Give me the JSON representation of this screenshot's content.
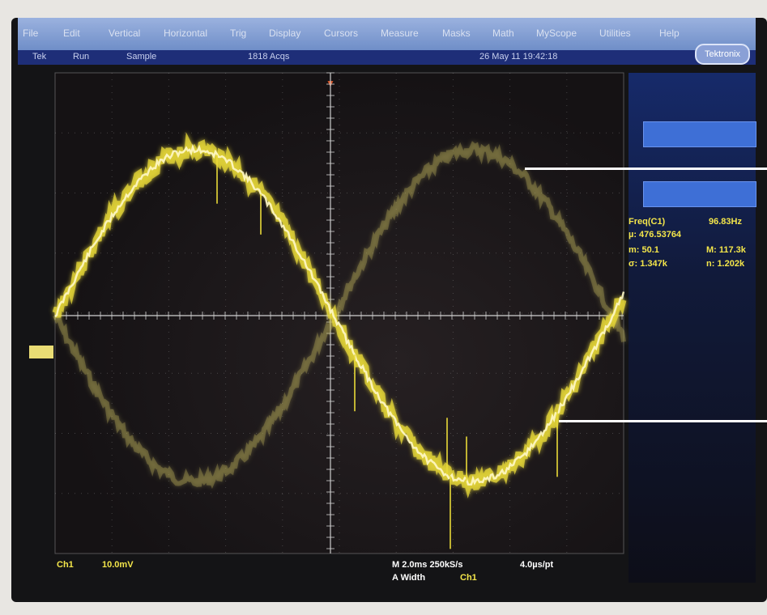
{
  "menu": {
    "items": [
      "File",
      "Edit",
      "Vertical",
      "Horizontal",
      "Trig",
      "Display",
      "Cursors",
      "Measure",
      "Masks",
      "Math",
      "MyScope",
      "Utilities",
      "Help"
    ]
  },
  "status": {
    "mode": "Tek",
    "run": "Run",
    "acq": "Sample",
    "acqs": "1818 Acqs",
    "datetime": "26 May 11 19:42:18"
  },
  "brand": "Tektronix",
  "measurements": {
    "freq_label": "Freq(C1)",
    "freq_value": "96.83Hz",
    "mu": "µ: 476.53764",
    "m_label": "m: 50.1",
    "M_label": "M: 117.3k",
    "sigma": "σ: 1.347k",
    "n": "n: 1.202k"
  },
  "bottom": {
    "channel": "Ch1",
    "scale": "10.0mV",
    "timebase": "M 2.0ms 250kS/s",
    "points": "4.0µs/pt",
    "width": "A Width",
    "trigger_ch": "Ch1"
  },
  "colors": {
    "trace_bright": "#fff8c8",
    "trace_yellow": "#e8da38",
    "trace_faded": "#b8ad58",
    "grid": "#cfcfcf",
    "menu": "#7d97cf",
    "status": "#1e2e78",
    "readout": "#f4e64a"
  }
}
